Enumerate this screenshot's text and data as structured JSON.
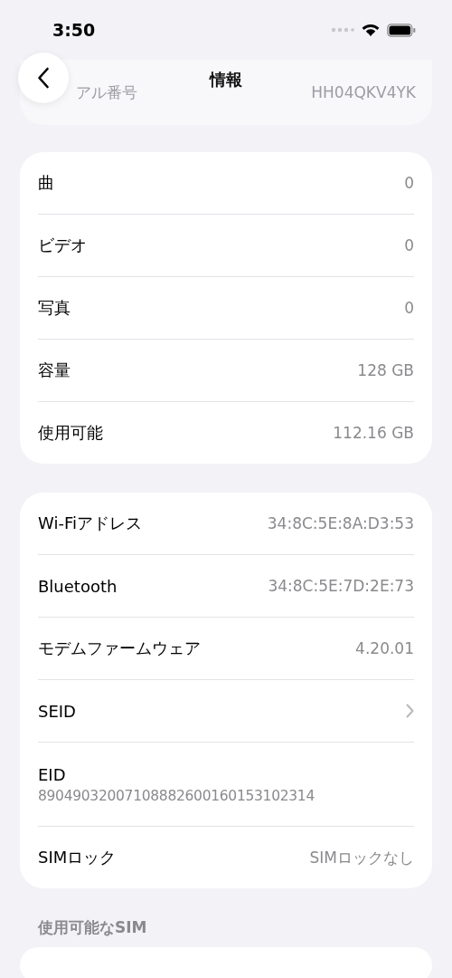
{
  "status_bar": {
    "time": "3:50"
  },
  "background_row": {
    "label": "アル番号",
    "value": "HH04QKV4YK"
  },
  "nav": {
    "title": "情報"
  },
  "groups": [
    {
      "rows": [
        {
          "kind": "value",
          "label": "曲",
          "value": "0"
        },
        {
          "kind": "value",
          "label": "ビデオ",
          "value": "0"
        },
        {
          "kind": "value",
          "label": "写真",
          "value": "0"
        },
        {
          "kind": "value",
          "label": "容量",
          "value": "128 GB"
        },
        {
          "kind": "value",
          "label": "使用可能",
          "value": "112.16 GB"
        }
      ]
    },
    {
      "rows": [
        {
          "kind": "value",
          "label": "Wi-Fiアドレス",
          "value": "34:8C:5E:8A:D3:53"
        },
        {
          "kind": "value",
          "label": "Bluetooth",
          "value": "34:8C:5E:7D:2E:73"
        },
        {
          "kind": "value",
          "label": "モデムファームウェア",
          "value": "4.20.01"
        },
        {
          "kind": "link",
          "label": "SEID"
        },
        {
          "kind": "stacked",
          "label": "EID",
          "value": "89049032007108882600160153102314"
        },
        {
          "kind": "value",
          "label": "SIMロック",
          "value": "SIMロックなし"
        }
      ]
    },
    {
      "header": "使用可能なSIM"
    }
  ]
}
